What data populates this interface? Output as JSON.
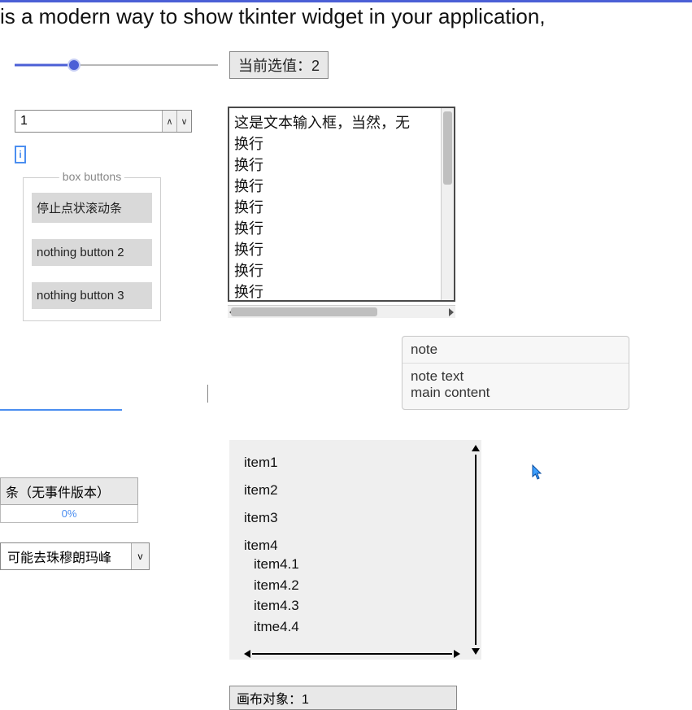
{
  "heading": "is a modern way to show tkinter widget in your application,",
  "slider": {
    "value": 2,
    "percent": 29,
    "label_prefix": "当前选值："
  },
  "spinbox": {
    "value": "1"
  },
  "info_badge": "i",
  "labelframe": {
    "title": "box buttons",
    "buttons": [
      "停止点状滚动条",
      "nothing button 2",
      "nothing button 3"
    ]
  },
  "textarea": {
    "lines": [
      "这是文本输入框，当然，无",
      "换行",
      "换行",
      "换行",
      "换行",
      "换行",
      "换行",
      "换行",
      "换行"
    ]
  },
  "note": {
    "title": "note",
    "body": "note text\nmain content"
  },
  "progress": {
    "label": "条（无事件版本）",
    "percent_text": "0%"
  },
  "combobox": {
    "selected": "可能去珠穆朗玛峰",
    "caret": "v"
  },
  "tree": {
    "items": [
      "item1",
      "item2",
      "item3"
    ],
    "item4": {
      "label": "item4",
      "children": [
        "item4.1",
        "item4.2",
        "item4.3",
        "itme4.4"
      ]
    }
  },
  "bottom_cut": "画布对象：1",
  "spin_glyphs": {
    "up": "∧",
    "down": "∨"
  }
}
